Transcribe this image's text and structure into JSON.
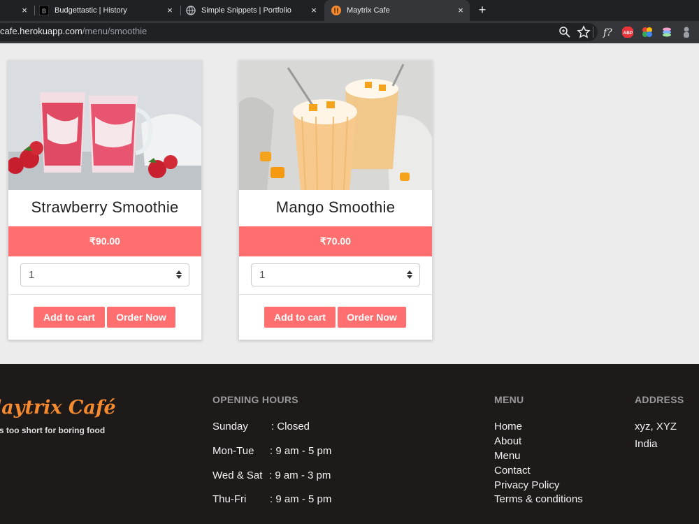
{
  "browser": {
    "tabs": [
      {
        "label": ""
      },
      {
        "label": "Budgettastic | History"
      },
      {
        "label": "Simple Snippets | Portfolio"
      },
      {
        "label": "Maytrix Cafe"
      }
    ],
    "url_host": "cafe.herokuapp.com",
    "url_path": "/menu/smoothie",
    "tab_close_glyph": "×",
    "new_tab_glyph": "+"
  },
  "products": [
    {
      "name": "Strawberry Smoothie",
      "price": "₹90.00",
      "qty": "1",
      "add_label": "Add to cart",
      "order_label": "Order Now"
    },
    {
      "name": "Mango Smoothie",
      "price": "₹70.00",
      "qty": "1",
      "add_label": "Add to cart",
      "order_label": "Order Now"
    }
  ],
  "footer": {
    "brand": "laytrix Café",
    "tagline": "'s too short for boring food",
    "hours_title": "OPENING HOURS",
    "hours": [
      {
        "day": "Sunday",
        "time": ":  Closed"
      },
      {
        "day": "Mon-Tue",
        "time": ":  9 am - 5 pm"
      },
      {
        "day": "Wed & Sat",
        "time": ":  9 am - 3 pm"
      },
      {
        "day": "Thu-Fri",
        "time": ":  9 am - 5 pm"
      }
    ],
    "menu_title": "MENU",
    "menu_links": [
      "Home",
      "About",
      "Menu",
      "Contact",
      "Privacy Policy",
      "Terms & conditions"
    ],
    "address_title": "ADDRESS",
    "address_lines": [
      "xyz, XYZ",
      "India"
    ]
  },
  "colors": {
    "accent": "#ff6f6f",
    "brand": "#f58a2f",
    "footer_bg": "#1d1a19"
  }
}
